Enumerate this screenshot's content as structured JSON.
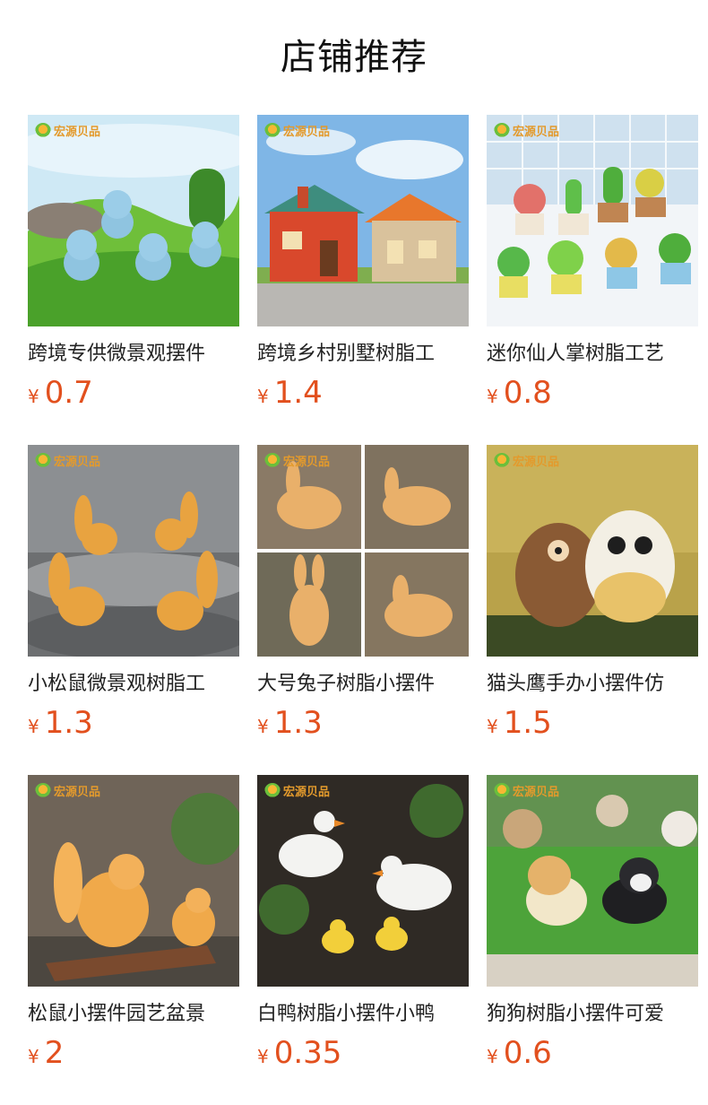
{
  "page": {
    "title": "店铺推荐"
  },
  "brand": {
    "logo_text": "宏源贝品"
  },
  "products": [
    {
      "title": "跨境专供微景观摆件",
      "currency": "¥",
      "price": "0.7",
      "image": "blue-elephants-on-grass"
    },
    {
      "title": "跨境乡村别墅树脂工",
      "currency": "¥",
      "price": "1.4",
      "image": "village-houses"
    },
    {
      "title": "迷你仙人掌树脂工艺",
      "currency": "¥",
      "price": "0.8",
      "image": "mini-cactus-pots"
    },
    {
      "title": "小松鼠微景观树脂工",
      "currency": "¥",
      "price": "1.3",
      "image": "squirrels-on-rocks"
    },
    {
      "title": "大号兔子树脂小摆件",
      "currency": "¥",
      "price": "1.3",
      "image": "rabbit-collage"
    },
    {
      "title": "猫头鹰手办小摆件仿",
      "currency": "¥",
      "price": "1.5",
      "image": "owls-on-moss"
    },
    {
      "title": "松鼠小摆件园艺盆景",
      "currency": "¥",
      "price": "2",
      "image": "squirrels-on-log"
    },
    {
      "title": "白鸭树脂小摆件小鸭",
      "currency": "¥",
      "price": "0.35",
      "image": "white-ducks-and-ducklings"
    },
    {
      "title": "狗狗树脂小摆件可爱",
      "currency": "¥",
      "price": "0.6",
      "image": "puppies-on-grass"
    }
  ],
  "colors": {
    "price": "#e2501e",
    "title": "#222222"
  }
}
